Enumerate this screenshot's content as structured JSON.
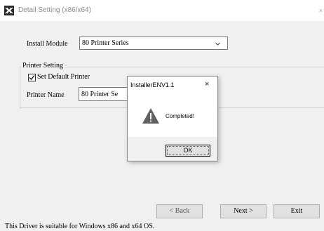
{
  "window": {
    "title": "Detail Setting (x86/x64)",
    "close_glyph": "×",
    "icon": "app-logo-icon"
  },
  "module": {
    "label": "Install Module",
    "selected": "80 Printer Series"
  },
  "printer_setting": {
    "group_label": "Printer Setting",
    "set_default_label": "Set Default Printer",
    "set_default_checked": true,
    "name_label": "Printer Name",
    "name_value": "80 Printer Se"
  },
  "buttons": {
    "back": "< Back",
    "next": "Next >",
    "exit": "Exit"
  },
  "status": {
    "text": "This Driver is suitable for Windows x86 and x64 OS."
  },
  "dialog": {
    "title": "InstallerENV1.1",
    "close_glyph": "×",
    "icon": "warning-icon",
    "message": "Completed!",
    "ok_label": "OK"
  },
  "colors": {
    "window_bg": "#f0f0f0",
    "titlebar_bg": "#ffffff",
    "title_text": "#8a8a8a",
    "warning_fill": "#606060"
  }
}
